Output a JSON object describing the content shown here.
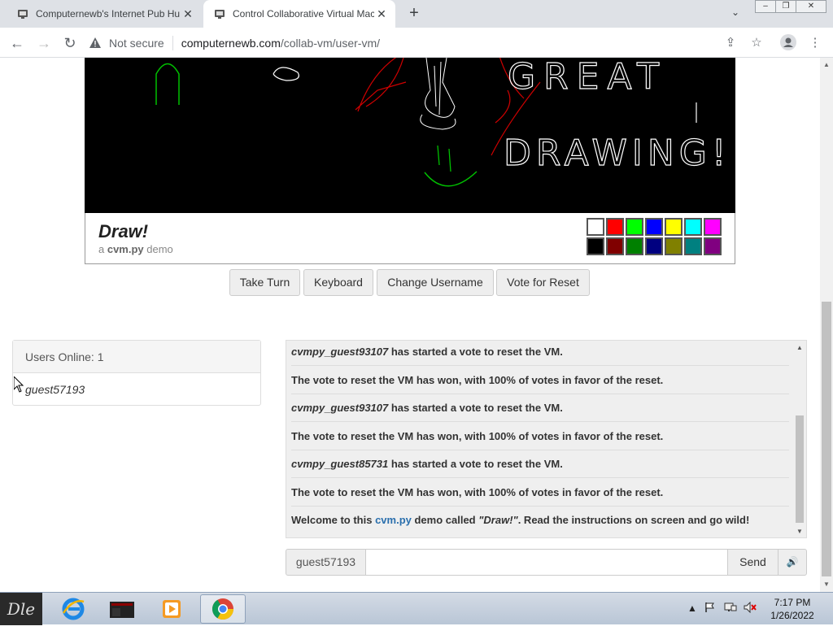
{
  "browser": {
    "tabs": [
      {
        "title": "Computernewb's Internet Pub Hu",
        "active": false
      },
      {
        "title": "Control Collaborative Virtual Mac",
        "active": true
      }
    ],
    "new_tab_icon": "+",
    "not_secure_label": "Not secure",
    "url_domain": "computernewb.com",
    "url_path": "/collab-vm/user-vm/"
  },
  "vm": {
    "title": "Draw!",
    "subtitle_prefix": "a ",
    "subtitle_name": "cvm.py",
    "subtitle_suffix": " demo",
    "palette_top": [
      "#ffffff",
      "#ff0000",
      "#00ff00",
      "#0000ff",
      "#ffff00",
      "#00ffff",
      "#ff00ff"
    ],
    "palette_bottom": [
      "#000000",
      "#800000",
      "#008000",
      "#000080",
      "#808000",
      "#008080",
      "#800080"
    ]
  },
  "actions": {
    "take_turn": "Take Turn",
    "keyboard": "Keyboard",
    "change_username": "Change Username",
    "vote_reset": "Vote for Reset"
  },
  "users": {
    "header": "Users Online: 1",
    "list": [
      "guest57193"
    ]
  },
  "chat": {
    "messages": [
      {
        "user": "cvmpy_guest93107",
        "text": " has started a vote to reset the VM."
      },
      {
        "user": "",
        "text": "The vote to reset the VM has won, with 100% of votes in favor of the reset."
      },
      {
        "user": "cvmpy_guest93107",
        "text": " has started a vote to reset the VM."
      },
      {
        "user": "",
        "text": "The vote to reset the VM has won, with 100% of votes in favor of the reset."
      },
      {
        "user": "cvmpy_guest85731",
        "text": " has started a vote to reset the VM."
      },
      {
        "user": "",
        "text": "The vote to reset the VM has won, with 100% of votes in favor of the reset."
      }
    ],
    "welcome": {
      "prefix": "Welcome to this ",
      "link": "cvm.py",
      "middle": " demo called ",
      "quote": "\"Draw!\"",
      "suffix": ". Read the instructions on screen and go wild!"
    },
    "username": "guest57193",
    "input_value": "",
    "send_label": "Send"
  },
  "canvas_text": {
    "line1": "GREAT",
    "line2": "DRAWING!"
  },
  "taskbar": {
    "start_label": "Dle",
    "time": "7:17 PM",
    "date": "1/26/2022"
  }
}
